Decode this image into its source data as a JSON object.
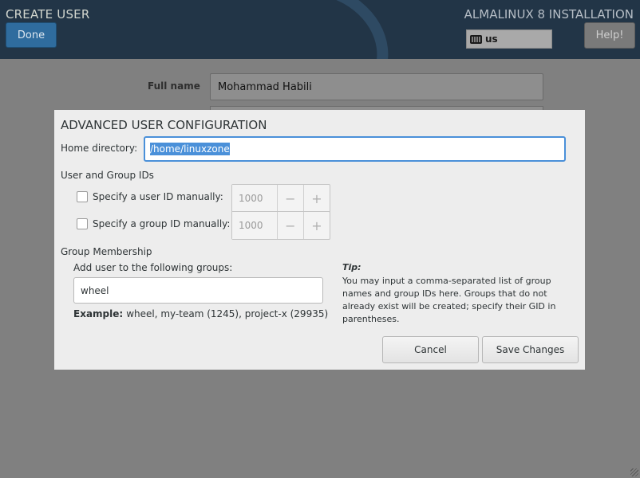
{
  "header": {
    "spoke_title": "CREATE USER",
    "done_label": "Done",
    "product_title": "ALMALINUX 8 INSTALLATION",
    "keyboard_layout": "us",
    "help_label": "Help!"
  },
  "form": {
    "full_name_label": "Full name",
    "full_name_value": "Mohammad Habili"
  },
  "dialog": {
    "title": "ADVANCED USER CONFIGURATION",
    "home_label": "Home directory:",
    "home_value": "/home/linuxzone",
    "ids_heading": "User and Group IDs",
    "uid_label": "Specify a user ID manually:",
    "uid_value": "1000",
    "gid_label": "Specify a group ID manually:",
    "gid_value": "1000",
    "minus": "−",
    "plus": "+",
    "membership_heading": "Group Membership",
    "groups_label": "Add user to the following groups:",
    "groups_value": "wheel",
    "example_label": "Example:",
    "example_text": "wheel, my-team (1245), project-x (29935)",
    "tip_heading": "Tip:",
    "tip_text": "You may input a comma-separated list of group names and group IDs here. Groups that do not already exist will be created; specify their GID in parentheses.",
    "cancel_label": "Cancel",
    "save_label": "Save Changes"
  },
  "colors": {
    "header_bg": "#223547",
    "accent": "#4a90d9",
    "done_button": "#2f6c9e",
    "dialog_bg": "#ededed"
  },
  "icons": {
    "keyboard": "keyboard-icon"
  }
}
